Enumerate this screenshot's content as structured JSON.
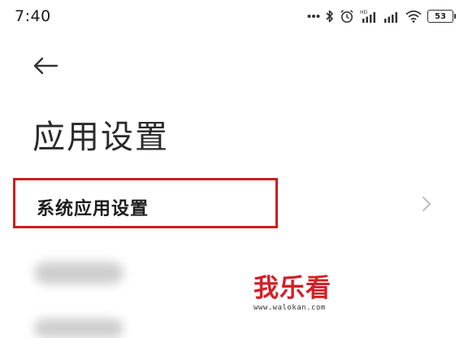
{
  "status_bar": {
    "time": "7:40",
    "hd_label": "HD",
    "battery_level": "53",
    "icons": [
      "more-dots-icon",
      "bluetooth-icon",
      "alarm-icon",
      "signal-hd-icon",
      "signal-icon",
      "wifi-icon",
      "battery-icon"
    ]
  },
  "header": {
    "back_icon": "arrow-left-icon",
    "title": "应用设置"
  },
  "list": {
    "items": [
      {
        "label": "系统应用设置",
        "highlighted": true,
        "highlight_color": "#cc1f1f",
        "trailing_icon": "chevron-right-icon"
      }
    ]
  },
  "watermark": {
    "title": "我乐看",
    "url": "www.walokan.com",
    "color": "#d41f26"
  }
}
